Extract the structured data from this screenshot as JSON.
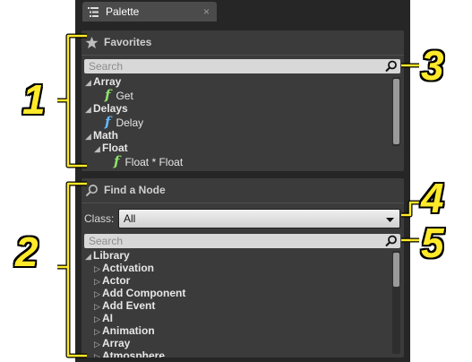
{
  "tab": {
    "title": "Palette",
    "close_glyph": "×",
    "icon": "palette-list-icon"
  },
  "favorites": {
    "title": "Favorites",
    "icon": "star-icon",
    "search": {
      "placeholder": "Search",
      "icon": "magnifier-icon"
    },
    "tree": [
      {
        "label": "Array",
        "kind": "category",
        "expanded": true
      },
      {
        "label": "Get",
        "kind": "function",
        "color": "#8ee36a"
      },
      {
        "label": "Delays",
        "kind": "category",
        "expanded": true
      },
      {
        "label": "Delay",
        "kind": "function",
        "color": "#67b7ff"
      },
      {
        "label": "Math",
        "kind": "category",
        "expanded": true
      },
      {
        "label": "Float",
        "kind": "category",
        "expanded": true
      },
      {
        "label": "Float * Float",
        "kind": "function",
        "color": "#8ee36a"
      }
    ]
  },
  "find_node": {
    "title": "Find a Node",
    "icon": "magnifier-icon",
    "class": {
      "label": "Class:",
      "value": "All"
    },
    "search": {
      "placeholder": "Search",
      "icon": "magnifier-icon"
    },
    "tree": [
      {
        "label": "Library",
        "kind": "category",
        "expanded": true
      },
      {
        "label": "Activation",
        "kind": "category",
        "expanded": false
      },
      {
        "label": "Actor",
        "kind": "category",
        "expanded": false
      },
      {
        "label": "Add Component",
        "kind": "category",
        "expanded": false
      },
      {
        "label": "Add Event",
        "kind": "category",
        "expanded": false
      },
      {
        "label": "AI",
        "kind": "category",
        "expanded": false
      },
      {
        "label": "Animation",
        "kind": "category",
        "expanded": false
      },
      {
        "label": "Array",
        "kind": "category",
        "expanded": false
      },
      {
        "label": "Atmosphere",
        "kind": "category",
        "expanded": false
      }
    ]
  },
  "callouts": {
    "c1": "1",
    "c2": "2",
    "c3": "3",
    "c4": "4",
    "c5": "5"
  },
  "colors": {
    "callout": "#ffea2a",
    "panel": "#262626",
    "section": "#3b3b3b"
  }
}
